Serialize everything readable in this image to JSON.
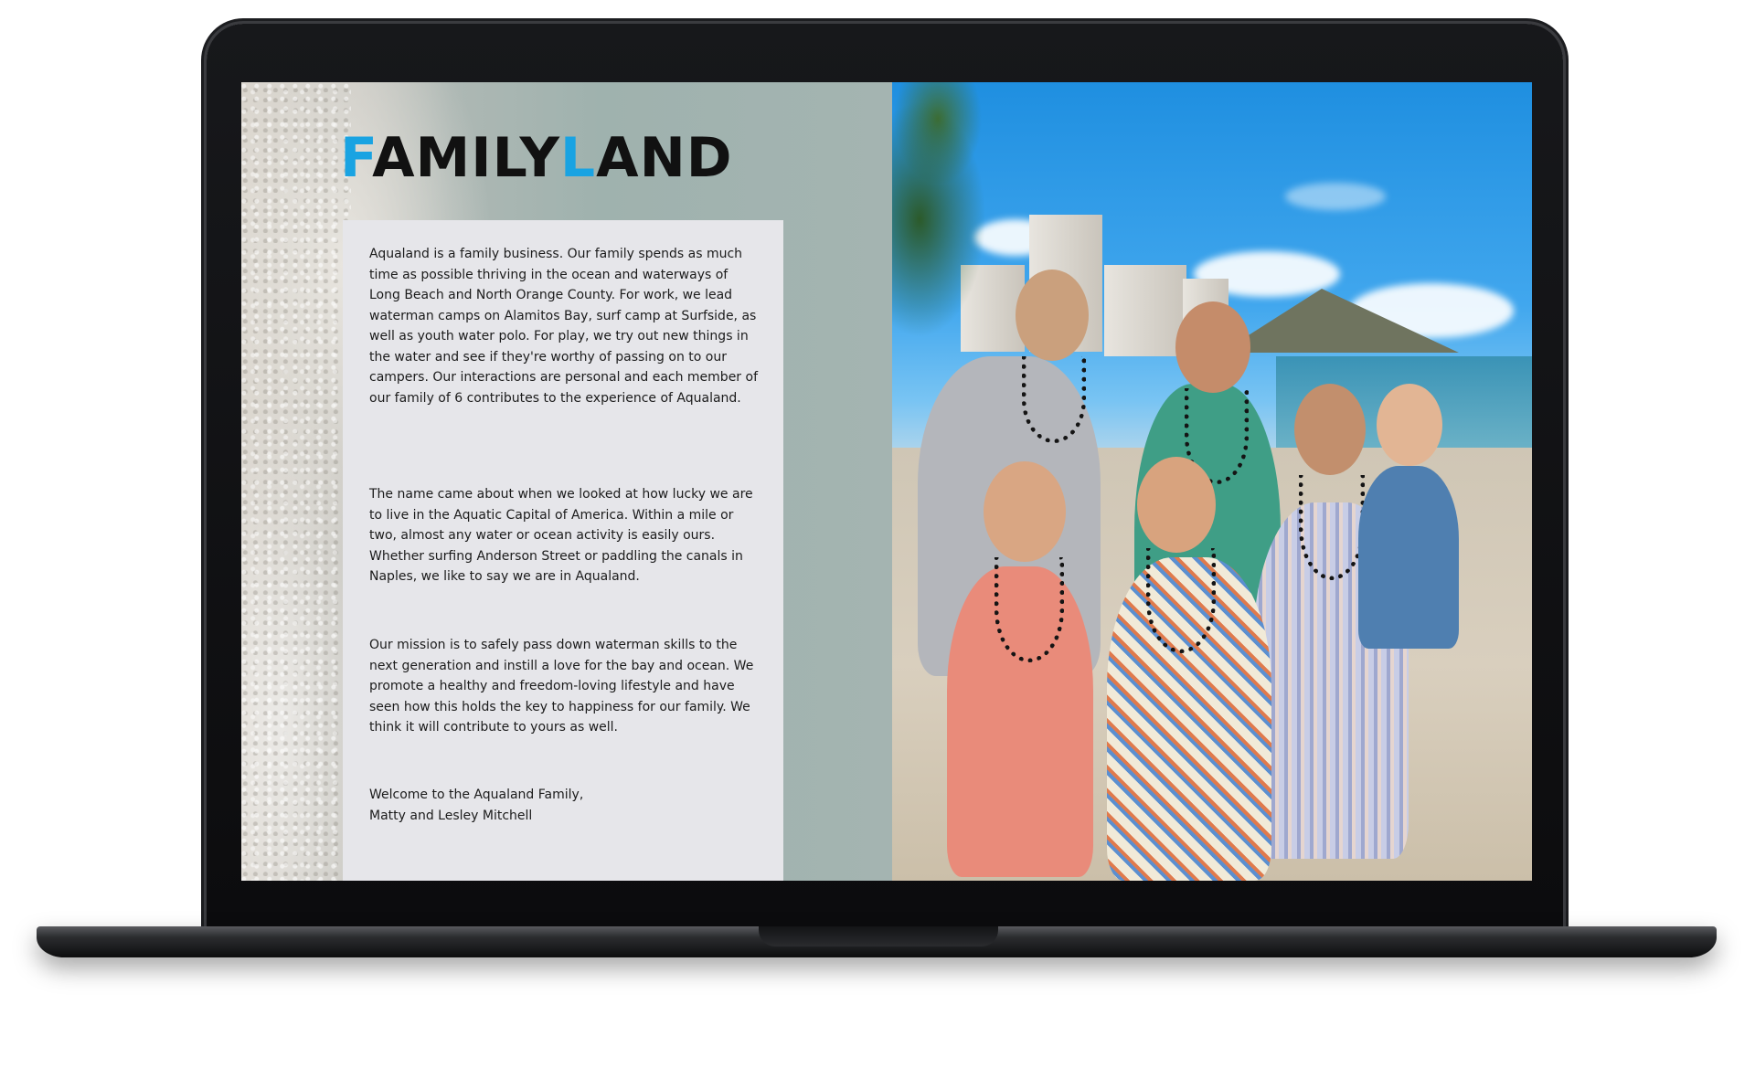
{
  "brand": {
    "logo_part1_accent": "F",
    "logo_part1": "AMILY",
    "logo_part2_accent": "L",
    "logo_part2": "AND",
    "accent_color": "#19a3e2",
    "text_color": "#111111"
  },
  "story": {
    "paragraph_1": "Aqualand is a family business. Our family spends as much time as possible thriving in the ocean and waterways of Long Beach and North Orange County. For work, we lead waterman camps on Alamitos Bay, surf camp at Surfside, as well as youth water polo. For play, we try out new things in the water and see if they're worthy of passing on to our campers. Our interactions are personal and each member of our family of 6 contributes to the experience of Aqualand.",
    "paragraph_2": "The name came about when we looked at how lucky we are to live in the Aquatic Capital of America. Within a mile or two, almost any water or ocean activity is easily ours. Whether surfing Anderson Street or paddling the canals in Naples, we like to say we are in Aqualand.",
    "paragraph_3": "Our mission is to safely pass down waterman skills to the next generation and instill a love for the bay and ocean. We promote a healthy and freedom-loving lifestyle and have seen how this holds the key to happiness for our family. We think it will contribute to yours as well.",
    "sign_off_line_1": "Welcome to the Aqualand Family,",
    "sign_off_line_2": "Matty and Lesley Mitchell"
  },
  "photo": {
    "subject": "family-photo"
  }
}
